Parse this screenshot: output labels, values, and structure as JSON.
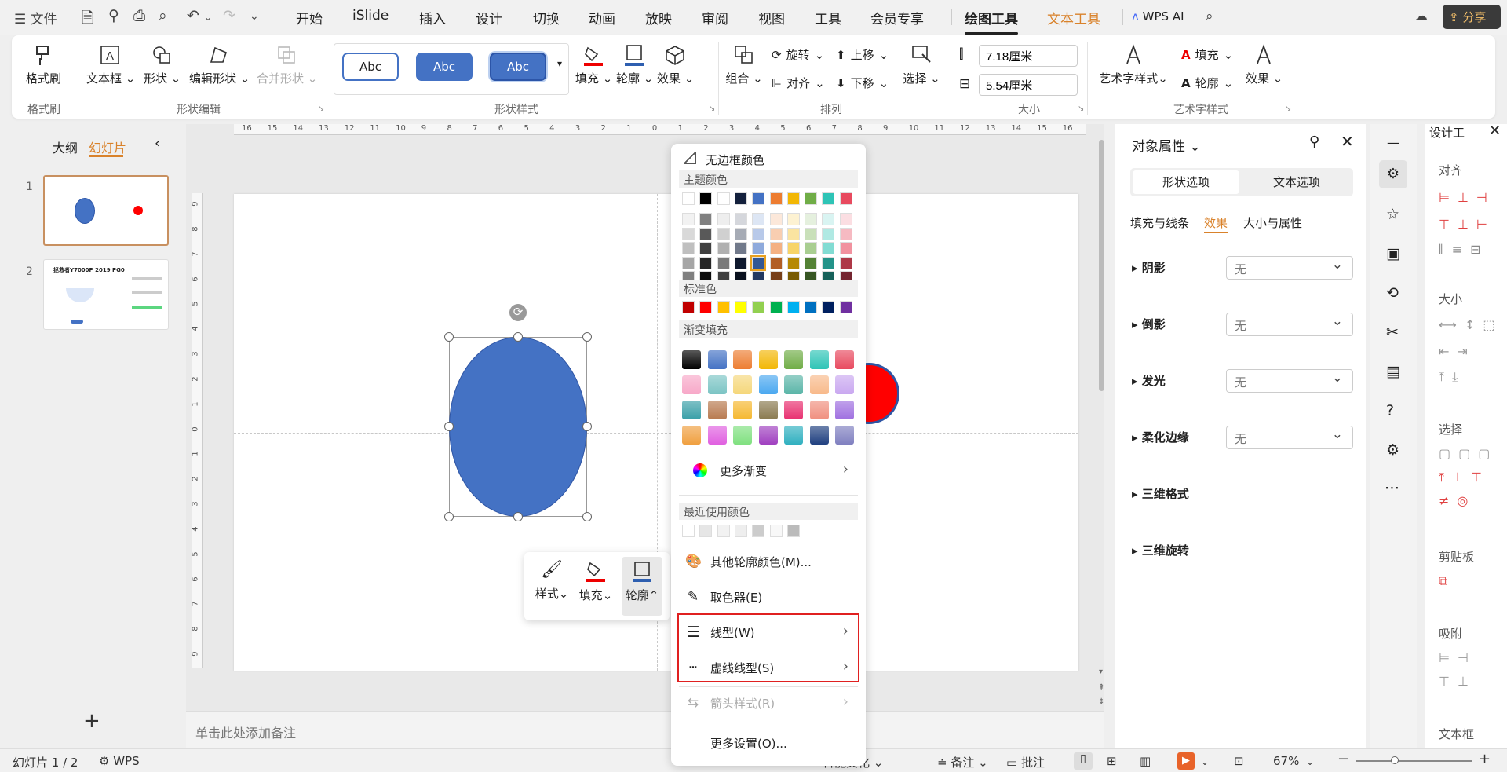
{
  "menubar": {
    "file_label": "文件",
    "tabs": [
      "开始",
      "iSlide",
      "插入",
      "设计",
      "切换",
      "动画",
      "放映",
      "审阅",
      "视图",
      "工具",
      "会员专享"
    ],
    "context_tabs": [
      "绘图工具",
      "文本工具"
    ],
    "wps_ai": "WPS AI",
    "share": "分享"
  },
  "ribbon": {
    "format_painter": "格式刷",
    "format_painter_group": "格式刷",
    "textbox": "文本框",
    "shape": "形状",
    "edit_shape": "编辑形状",
    "merge_shape": "合并形状",
    "shape_edit_group": "形状编辑",
    "style_samples": [
      "Abc",
      "Abc",
      "Abc"
    ],
    "fill": "填充",
    "outline": "轮廓",
    "effect": "效果",
    "shape_style_group": "形状样式",
    "group": "组合",
    "rotate": "旋转",
    "align": "对齐",
    "bring_forward": "上移",
    "send_backward": "下移",
    "select": "选择",
    "arrange_group": "排列",
    "width": "7.18厘米",
    "height": "5.54厘米",
    "size_group": "大小",
    "art_text": "艺术字样式",
    "art_fill": "填充",
    "art_outline": "轮廓",
    "art_effect": "效果",
    "art_group": "艺术字样式"
  },
  "left_panel": {
    "tab_outline": "大纲",
    "tab_slides": "幻灯片",
    "slide_numbers": [
      "1",
      "2"
    ],
    "thumb2_title": "拯救者Y7000P 2019 PG0"
  },
  "ruler_h": [
    "16",
    "15",
    "14",
    "13",
    "12",
    "11",
    "10",
    "9",
    "8",
    "7",
    "6",
    "5",
    "4",
    "3",
    "2",
    "1",
    "0",
    "1",
    "2",
    "3",
    "4",
    "5",
    "6",
    "7",
    "8",
    "9",
    "10",
    "11",
    "12",
    "13",
    "14",
    "15",
    "16"
  ],
  "ruler_v": [
    "9",
    "8",
    "7",
    "6",
    "5",
    "4",
    "3",
    "2",
    "1",
    "0",
    "1",
    "2",
    "3",
    "4",
    "5",
    "6",
    "7",
    "8",
    "9"
  ],
  "notes_placeholder": "单击此处添加备注",
  "mini_toolbar": {
    "style": "样式",
    "fill": "填充",
    "outline": "轮廓"
  },
  "popup": {
    "no_border": "无边框颜色",
    "theme_colors": "主题颜色",
    "standard_colors": "标准色",
    "gradient_fill": "渐变填充",
    "more_gradient": "更多渐变",
    "recent_colors": "最近使用颜色",
    "other_colors": "其他轮廓颜色(M)...",
    "eyedropper": "取色器(E)",
    "line_type": "线型(W)",
    "dash_type": "虚线线型(S)",
    "arrow_style": "箭头样式(R)",
    "more_settings": "更多设置(O)...",
    "theme_top": [
      "#ffffff",
      "#000000",
      "#ffffff",
      "#14213d",
      "#4472c4",
      "#ed7d31",
      "#f2b705",
      "#70ad47",
      "#2ec4b6",
      "#e84a5f"
    ],
    "standard": [
      "#c00000",
      "#ff0000",
      "#ffc000",
      "#ffff00",
      "#92d050",
      "#00b050",
      "#00b0f0",
      "#0070c0",
      "#002060",
      "#7030a0"
    ],
    "gradients": [
      [
        "#000000",
        "#4472c4",
        "#ed7d31",
        "#f2b705",
        "#70ad47",
        "#2ec4b6",
        "#e84a5f"
      ],
      [
        "#f7a8c8",
        "#7bc4c4",
        "#f5d77a",
        "#4aa8f0",
        "#5ab5a8",
        "#f8b98a",
        "#c9a8f0"
      ],
      [
        "#3aa0a8",
        "#b87a50",
        "#f5b830",
        "#8a7a50",
        "#e83070",
        "#f09080",
        "#a070e0"
      ],
      [
        "#f0a040",
        "#e060e0",
        "#80e080",
        "#a040c0",
        "#30b0c0",
        "#204080",
        "#8080c0"
      ]
    ],
    "recent": [
      "#ffffff",
      "#e6e6e6",
      "#f2f2f2",
      "#eeeeee",
      "#cccccc",
      "#f8f8f8",
      "#bbbbbb"
    ]
  },
  "obj_panel": {
    "title": "对象属性",
    "tab_shape": "形状选项",
    "tab_text": "文本选项",
    "sub_fill": "填充与线条",
    "sub_effect": "效果",
    "sub_size": "大小与属性",
    "rows": [
      {
        "label": "阴影",
        "value": "无"
      },
      {
        "label": "倒影",
        "value": "无"
      },
      {
        "label": "发光",
        "value": "无"
      },
      {
        "label": "柔化边缘",
        "value": "无"
      },
      {
        "label": "三维格式",
        "value": ""
      },
      {
        "label": "三维旋转",
        "value": ""
      }
    ]
  },
  "design_panel": {
    "title": "设计工",
    "align": "对齐",
    "size": "大小",
    "select": "选择",
    "clipboard": "剪贴板",
    "snap": "吸附",
    "textbox": "文本框"
  },
  "status": {
    "slide_info": "幻灯片 1 / 2",
    "wps": "WPS",
    "beautify": "智能美化",
    "notes": "备注",
    "comments": "批注",
    "zoom": "67%"
  },
  "colors": {
    "accent_orange": "#d9822b",
    "ellipse_blue": "#4472c4",
    "circle_red": "#ff0000",
    "highlight_red": "#e02020"
  }
}
